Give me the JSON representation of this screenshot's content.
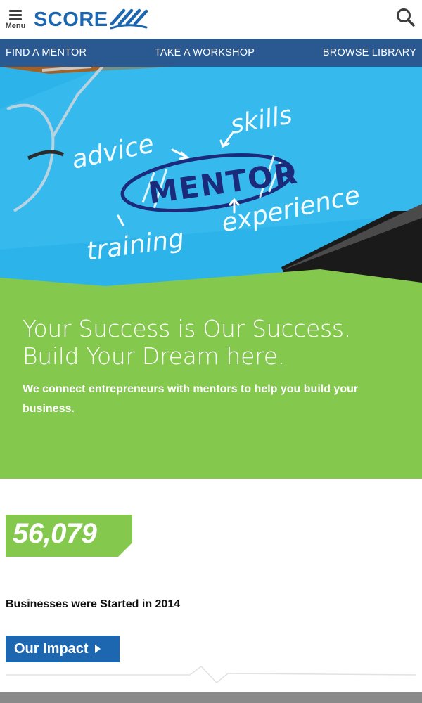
{
  "header": {
    "menu_label": "Menu",
    "logo_text": "SCORE",
    "brand_color": "#1d67b1",
    "menu_icon": "hamburger-icon",
    "search_icon": "search-icon"
  },
  "nav": {
    "items": [
      {
        "label": "FIND A MENTOR"
      },
      {
        "label": "TAKE A WORKSHOP"
      },
      {
        "label": "BROWSE LIBRARY"
      }
    ],
    "background_color": "#2a5890"
  },
  "hero_image": {
    "words": [
      "advice",
      "skills",
      "MENTOR",
      "training",
      "experience"
    ]
  },
  "banner": {
    "headline_line1": "Your Success is Our Success.",
    "headline_line2": "Build Your Dream here.",
    "subtext": "We connect entrepreneurs with mentors to help you build your business.",
    "background_color": "#84c94e"
  },
  "stats": {
    "number": "56,079",
    "caption": "Businesses were Started in 2014",
    "button_label": "Our Impact",
    "button_icon": "play-triangle-icon"
  }
}
